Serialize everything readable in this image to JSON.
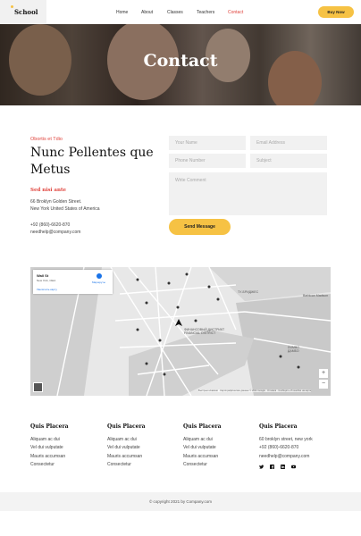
{
  "brand": {
    "logo": "School"
  },
  "nav": {
    "items": [
      "Home",
      "About",
      "Classes",
      "Teachers",
      "Contact"
    ],
    "active": "Contact",
    "buy_label": "Buy Now"
  },
  "hero": {
    "title": "Contact"
  },
  "contact": {
    "kicker": "Obortis et Tdio",
    "heading": "Nunc Pellentes que Metus",
    "subhead": "Sed nisi ante",
    "address_line1": "66 Broklyn Golden Street.",
    "address_line2": "New York United States of America",
    "phone": "+92 (860)-6620-870",
    "email": "needhelp@company.com"
  },
  "form": {
    "name_placeholder": "Your Name",
    "email_placeholder": "Email Address",
    "phone_placeholder": "Phone Number",
    "subject_placeholder": "Subject",
    "comment_placeholder": "Write Comment",
    "send_label": "Send Message"
  },
  "map": {
    "card_title": "Wall St",
    "card_sub": "New York, США",
    "card_link": "Увеличить карту",
    "directions": "Маршруты",
    "labels": [
      "ТУ-БРИДЖЕС",
      "FINANCIAL DISTRICT",
      "ФИНАНСОВЫЙ ДИСТРИКТ",
      "Barbican Madison",
      "DUMBO",
      "ДАМБО"
    ],
    "zoom_in": "+",
    "zoom_out": "−",
    "attribution": "Быстрые клавиши · Картографические данные © 2021 Google · Условия · Сообщить об ошибке на карте"
  },
  "footer": {
    "columns": [
      {
        "title": "Quis Placera",
        "links": [
          "Aliquam ac dui",
          "Vel dui vulputate",
          "Mauris accumsan",
          "Consectetur"
        ]
      },
      {
        "title": "Quis Placera",
        "links": [
          "Aliquam ac dui",
          "Vel dui vulputate",
          "Mauris accumsan",
          "Consectetur"
        ]
      },
      {
        "title": "Quis Placera",
        "links": [
          "Aliquam ac dui",
          "Vel dui vulputate",
          "Mauris accumsan",
          "Consectetur"
        ]
      },
      {
        "title": "Quis Placera",
        "links": [
          "60 broklyn street, new york",
          "+92 (860)-6620-870",
          "needhelp@company.com"
        ]
      }
    ],
    "social_icons": [
      "twitter-icon",
      "facebook-icon",
      "linkedin-icon",
      "youtube-icon"
    ],
    "copyright": "© copyright 2021 by Company.com"
  },
  "colors": {
    "accent": "#f6c244",
    "red": "#e0443d"
  }
}
